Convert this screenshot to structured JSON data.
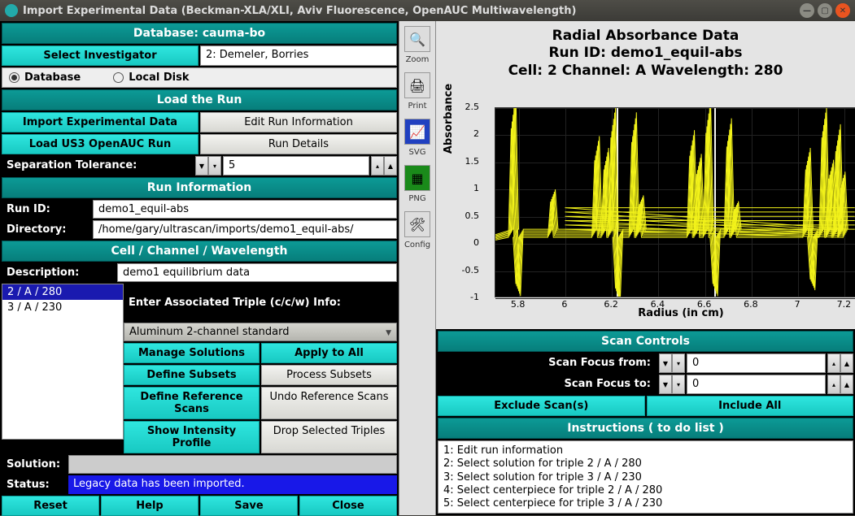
{
  "window": {
    "title": "Import Experimental Data (Beckman-XLA/XLI, Aviv Fluorescence, OpenAUC Multiwavelength)"
  },
  "db": {
    "header": "Database: cauma-bo",
    "select_inv": "Select Investigator",
    "investigator": "2: Demeler, Borries",
    "radio_db": "Database",
    "radio_local": "Local Disk"
  },
  "load": {
    "header": "Load the Run",
    "import_btn": "Import Experimental Data",
    "edit_btn": "Edit Run Information",
    "openauc_btn": "Load US3 OpenAUC Run",
    "details_btn": "Run Details",
    "sep_tol_label": "Separation Tolerance:",
    "sep_tol_val": "5"
  },
  "runinfo": {
    "header": "Run Information",
    "runid_label": "Run ID:",
    "runid_val": "demo1_equil-abs",
    "dir_label": "Directory:",
    "dir_val": "/home/gary/ultrascan/imports/demo1_equil-abs/"
  },
  "ccw": {
    "header": "Cell / Channel / Wavelength",
    "desc_label": "Description:",
    "desc_val": "demo1 equilibrium data",
    "triples": [
      "2 / A / 280",
      "3 / A / 230"
    ],
    "enter_triple": "Enter Associated Triple (c/c/w) Info:",
    "centerpiece": "Aluminum 2-channel standard",
    "manage_sol": "Manage Solutions",
    "apply_all": "Apply to All",
    "define_subsets": "Define Subsets",
    "process_subsets": "Process Subsets",
    "define_ref": "Define Reference Scans",
    "undo_ref": "Undo Reference Scans",
    "show_intensity": "Show Intensity Profile",
    "drop_triples": "Drop Selected Triples"
  },
  "solution": {
    "label": "Solution:",
    "val": ""
  },
  "status": {
    "label": "Status:",
    "val": "Legacy data has been imported."
  },
  "footer": {
    "reset": "Reset",
    "help": "Help",
    "save": "Save",
    "close": "Close"
  },
  "mid": {
    "zoom": "Zoom",
    "print": "Print",
    "svg": "SVG",
    "png": "PNG",
    "config": "Config"
  },
  "chart_data": {
    "type": "line",
    "title": "Radial Absorbance Data",
    "subtitle1": "Run ID: demo1_equil-abs",
    "subtitle2": "Cell: 2  Channel: A  Wavelength: 280",
    "xlabel": "Radius (in cm)",
    "ylabel": "Absorbance",
    "xlim": [
      5.7,
      7.3
    ],
    "ylim": [
      -1.0,
      2.5
    ],
    "xticks": [
      5.8,
      6,
      6.2,
      6.4,
      6.6,
      6.8,
      7,
      7.2
    ],
    "yticks": [
      -1,
      -0.5,
      0,
      0.5,
      1,
      1.5,
      2,
      2.5
    ],
    "vertical_markers": [
      6.22,
      6.64
    ],
    "series_note": "Multiple overlapping yellow absorbance scans; baseline near 0 with sharp positive spikes near x≈5.78, 5.95, 6.14, 6.21, 6.30, 6.55, 6.62, 6.71, 7.05, 7.12, 7.18 reaching up to ~2.5, and negative spikes to ~-1 near 5.80, 6.23, 6.65, 7.07"
  },
  "scan": {
    "header": "Scan Controls",
    "from_label": "Scan Focus from:",
    "from_val": "0",
    "to_label": "Scan Focus to:",
    "to_val": "0",
    "exclude": "Exclude Scan(s)",
    "include": "Include All"
  },
  "instructions": {
    "header": "Instructions ( to do list )",
    "items": [
      "1: Edit run information",
      "2: Select solution for triple 2 / A / 280",
      "3: Select solution for triple 3 / A / 230",
      "4: Select centerpiece for triple 2 / A / 280",
      "5: Select centerpiece for triple 3 / A / 230"
    ]
  }
}
